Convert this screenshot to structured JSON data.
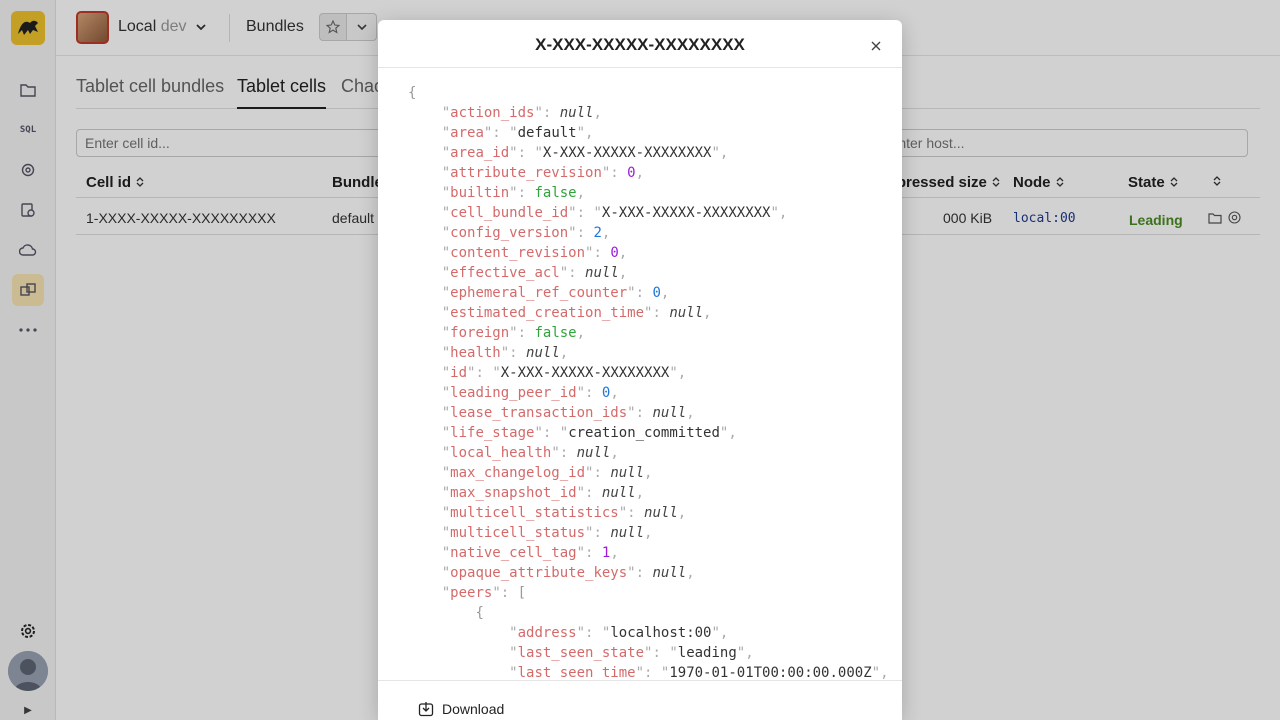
{
  "header": {
    "env_name": "Local",
    "env_sub": "dev",
    "title": "Bundles"
  },
  "tabs": [
    {
      "label": "Tablet cell bundles"
    },
    {
      "label": "Tablet cells"
    },
    {
      "label": "Chaos"
    }
  ],
  "filters": {
    "cell_placeholder": "Enter cell id...",
    "host_placeholder": "Enter host..."
  },
  "table": {
    "columns": [
      "Cell id",
      "Bundle",
      "Uncompressed size",
      "Node",
      "State"
    ],
    "row": {
      "cell_id": "1-XXXX-XXXXX-XXXXXXXXX",
      "bundle": "default",
      "size": "000 KiB",
      "node": "local:00",
      "state": "Leading"
    }
  },
  "modal": {
    "title": "X-XXX-XXXXX-XXXXXXXX",
    "download_label": "Download",
    "json_lines": [
      {
        "indent": 0,
        "punct": "{"
      },
      {
        "indent": 1,
        "key": "action_ids",
        "type": "null",
        "value": "null"
      },
      {
        "indent": 1,
        "key": "area",
        "type": "string",
        "value": "default"
      },
      {
        "indent": 1,
        "key": "area_id",
        "type": "string",
        "value": "X-XXX-XXXXX-XXXXXXXX"
      },
      {
        "indent": 1,
        "key": "attribute_revision",
        "type": "num-p",
        "value": "0"
      },
      {
        "indent": 1,
        "key": "builtin",
        "type": "false",
        "value": "false"
      },
      {
        "indent": 1,
        "key": "cell_bundle_id",
        "type": "string",
        "value": "X-XXX-XXXXX-XXXXXXXX"
      },
      {
        "indent": 1,
        "key": "config_version",
        "type": "num-b",
        "value": "2"
      },
      {
        "indent": 1,
        "key": "content_revision",
        "type": "num-p",
        "value": "0"
      },
      {
        "indent": 1,
        "key": "effective_acl",
        "type": "null",
        "value": "null"
      },
      {
        "indent": 1,
        "key": "ephemeral_ref_counter",
        "type": "num-b",
        "value": "0"
      },
      {
        "indent": 1,
        "key": "estimated_creation_time",
        "type": "null",
        "value": "null"
      },
      {
        "indent": 1,
        "key": "foreign",
        "type": "false",
        "value": "false"
      },
      {
        "indent": 1,
        "key": "health",
        "type": "null",
        "value": "null"
      },
      {
        "indent": 1,
        "key": "id",
        "type": "string",
        "value": "X-XXX-XXXXX-XXXXXXXX"
      },
      {
        "indent": 1,
        "key": "leading_peer_id",
        "type": "num-b",
        "value": "0"
      },
      {
        "indent": 1,
        "key": "lease_transaction_ids",
        "type": "null",
        "value": "null"
      },
      {
        "indent": 1,
        "key": "life_stage",
        "type": "string",
        "value": "creation_committed"
      },
      {
        "indent": 1,
        "key": "local_health",
        "type": "null",
        "value": "null"
      },
      {
        "indent": 1,
        "key": "max_changelog_id",
        "type": "null",
        "value": "null"
      },
      {
        "indent": 1,
        "key": "max_snapshot_id",
        "type": "null",
        "value": "null"
      },
      {
        "indent": 1,
        "key": "multicell_statistics",
        "type": "null",
        "value": "null"
      },
      {
        "indent": 1,
        "key": "multicell_status",
        "type": "null",
        "value": "null"
      },
      {
        "indent": 1,
        "key": "native_cell_tag",
        "type": "num-p",
        "value": "1"
      },
      {
        "indent": 1,
        "key": "opaque_attribute_keys",
        "type": "null",
        "value": "null"
      },
      {
        "indent": 1,
        "key": "peers",
        "type": "open",
        "value": "["
      },
      {
        "indent": 2,
        "punct": "{"
      },
      {
        "indent": 3,
        "key": "address",
        "type": "string",
        "value": "localhost:00"
      },
      {
        "indent": 3,
        "key": "last_seen_state",
        "type": "string",
        "value": "leading"
      },
      {
        "indent": 3,
        "key": "last_seen_time",
        "type": "string",
        "value": "1970-01-01T00:00:00.000Z"
      }
    ]
  }
}
